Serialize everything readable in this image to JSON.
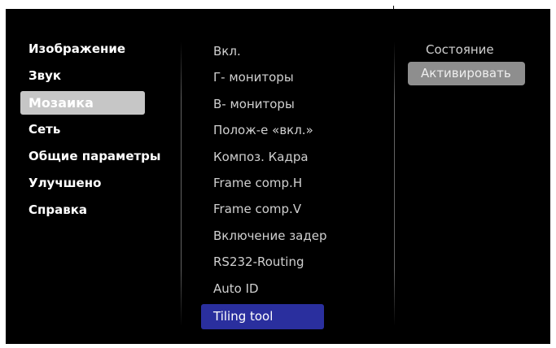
{
  "main_menu": [
    {
      "label": "Изображение",
      "selected": false
    },
    {
      "label": "Звук",
      "selected": false
    },
    {
      "label": "Мозаика",
      "selected": true
    },
    {
      "label": "Сеть",
      "selected": false
    },
    {
      "label": "Общие параметры",
      "selected": false
    },
    {
      "label": "Улучшено",
      "selected": false
    },
    {
      "label": "Справка",
      "selected": false
    }
  ],
  "submenu": [
    {
      "label": "Вкл.",
      "focused": false
    },
    {
      "label": "Г- мониторы",
      "focused": false
    },
    {
      "label": "В- мониторы",
      "focused": false
    },
    {
      "label": "Полож-е «вкл.»",
      "focused": false
    },
    {
      "label": "Композ. Кадра",
      "focused": false
    },
    {
      "label": "Frame comp.H",
      "focused": false
    },
    {
      "label": "Frame comp.V",
      "focused": false
    },
    {
      "label": "Включение задер",
      "focused": false
    },
    {
      "label": "RS232-Routing",
      "focused": false
    },
    {
      "label": "Auto ID",
      "focused": false
    },
    {
      "label": "Tiling tool",
      "focused": true
    }
  ],
  "options": [
    {
      "label": "Состояние",
      "selected": false
    },
    {
      "label": "Активировать",
      "selected": true
    }
  ],
  "colors": {
    "background": "#000000",
    "main_selected": "#c6c6c6",
    "submenu_focus": "#2a2f9e",
    "option_selected": "#8e8e8e"
  }
}
